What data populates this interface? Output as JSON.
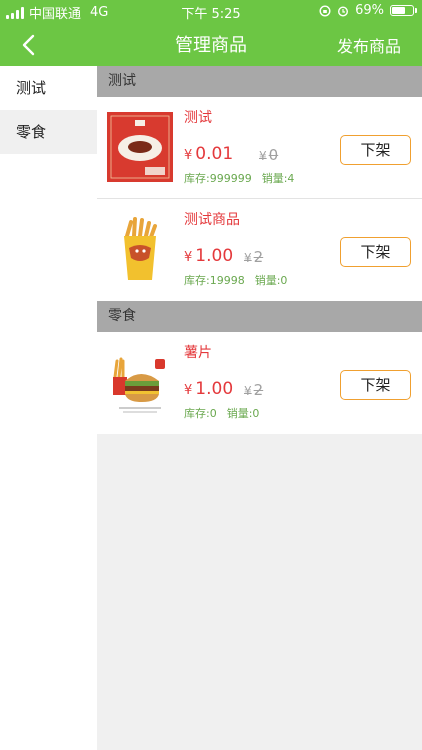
{
  "status_bar": {
    "carrier": "中国联通",
    "network": "4G",
    "time": "下午 5:25",
    "battery": "69%",
    "battery_level": 0.69
  },
  "nav": {
    "title": "管理商品",
    "publish_label": "发布商品",
    "back_icon": "chevron-left-icon"
  },
  "sidebar": {
    "items": [
      {
        "label": "测试"
      },
      {
        "label": "零食"
      }
    ]
  },
  "categories": [
    {
      "name": "测试",
      "products": [
        {
          "name": "测试",
          "yen": "¥",
          "price": "0.01",
          "original_price": "0",
          "stock": "库存:999999",
          "sales": "销量:4",
          "button": "下架"
        },
        {
          "name": "测试商品",
          "yen": "¥",
          "price": "1.00",
          "original_price": "2",
          "stock": "库存:19998",
          "sales": "销量:0",
          "button": "下架"
        }
      ]
    },
    {
      "name": "零食",
      "products": [
        {
          "name": "薯片",
          "yen": "¥",
          "price": "1.00",
          "original_price": "2",
          "stock": "库存:0",
          "sales": "销量:0",
          "button": "下架"
        }
      ]
    }
  ],
  "colors": {
    "brand": "#6cc644",
    "price": "#e4393c",
    "stats": "#6aa84f",
    "button_border": "#f0a030"
  }
}
